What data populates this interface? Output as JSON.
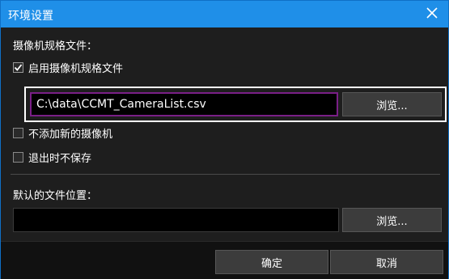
{
  "window": {
    "title": "环境设置",
    "close_icon": "close-icon",
    "accent_color": "#1f8fe8"
  },
  "camera_spec": {
    "section_label": "摄像机规格文件：",
    "enable_checkbox": {
      "label": "启用摄像机规格文件",
      "checked": true
    },
    "file_path": "C:\\data\\CCMT_CameraList.csv",
    "browse_label": "浏览..."
  },
  "options": {
    "no_new_camera": {
      "label": "不添加新的摄像机",
      "checked": false
    },
    "exit_without_save": {
      "label": "退出时不保存",
      "checked": false
    }
  },
  "default_location": {
    "section_label": "默认的文件位置：",
    "path": "",
    "browse_label": "浏览..."
  },
  "footer": {
    "ok_label": "确定",
    "cancel_label": "取消"
  }
}
